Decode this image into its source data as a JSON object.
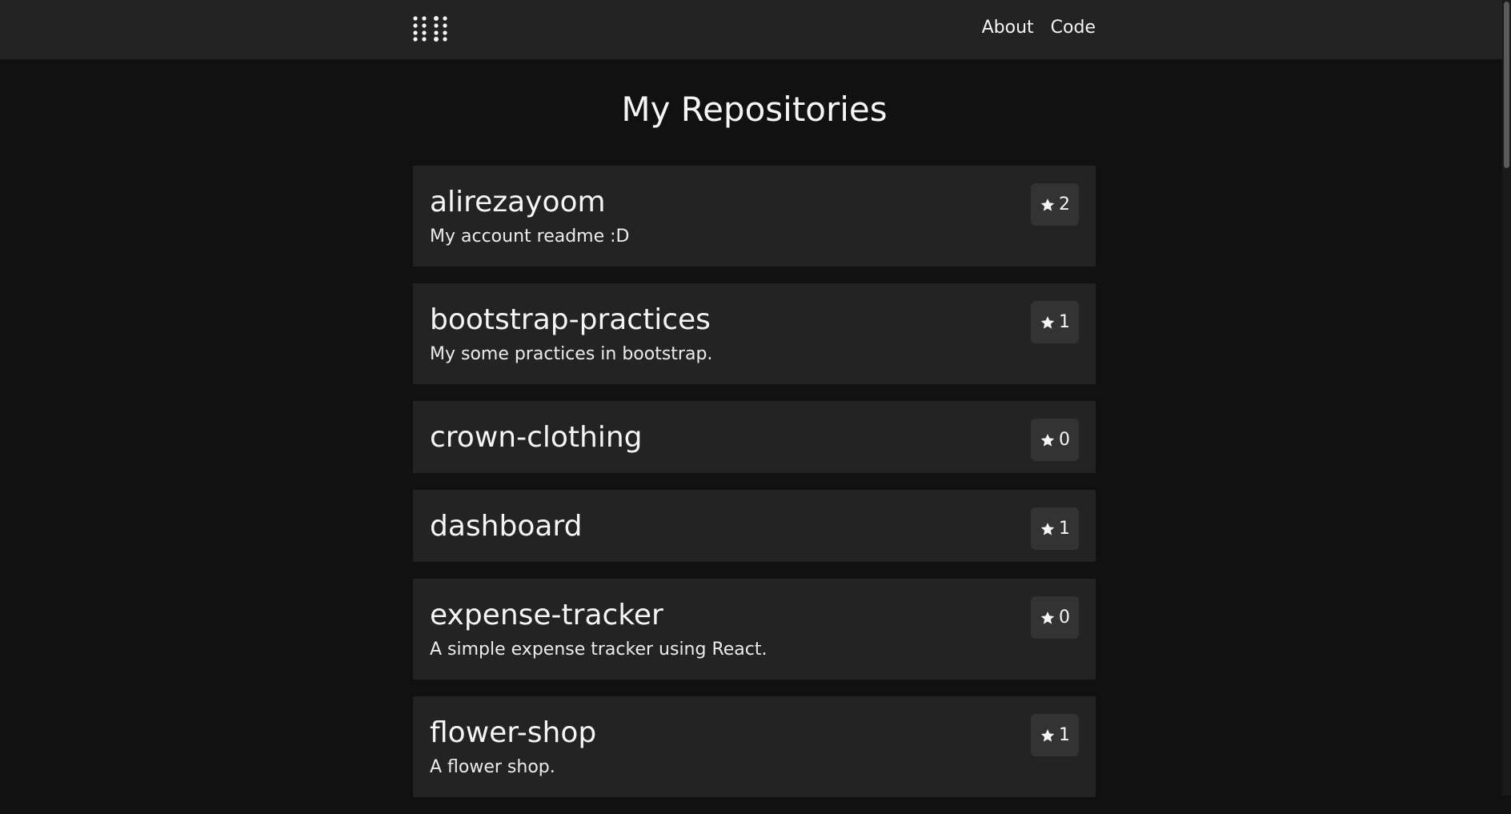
{
  "nav": {
    "logo_icon": "dots-grid-icon",
    "links": [
      {
        "label": "About"
      },
      {
        "label": "Code"
      }
    ]
  },
  "page": {
    "title": "My Repositories"
  },
  "repositories": [
    {
      "name": "alirezayoom",
      "description": "My account readme :D",
      "stars": "2"
    },
    {
      "name": "bootstrap-practices",
      "description": "My some practices in bootstrap.",
      "stars": "1"
    },
    {
      "name": "crown-clothing",
      "description": "",
      "stars": "0"
    },
    {
      "name": "dashboard",
      "description": "",
      "stars": "1"
    },
    {
      "name": "expense-tracker",
      "description": "A simple expense tracker using React.",
      "stars": "0"
    },
    {
      "name": "flower-shop",
      "description": "A flower shop.",
      "stars": "1"
    }
  ],
  "colors": {
    "background": "#111111",
    "navbar": "#232323",
    "card": "#232323",
    "badge": "#333333",
    "text": "#f5f5f5"
  }
}
